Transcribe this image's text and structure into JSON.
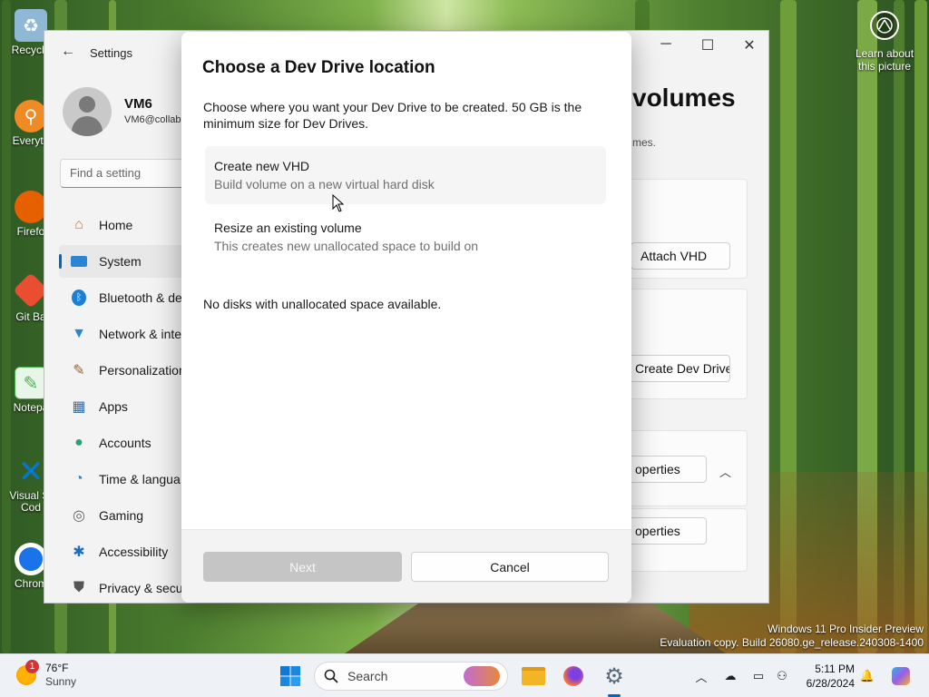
{
  "desktop": {
    "icons": [
      {
        "label": "Recycle",
        "icon": "recycle-bin-icon",
        "color": "#8fb7d6"
      },
      {
        "label": "Everyth",
        "icon": "everything-search-icon",
        "color": "#f08a24"
      },
      {
        "label": "Firefo",
        "icon": "firefox-icon",
        "color": "#e66000"
      },
      {
        "label": "Git Ba",
        "icon": "git-bash-icon",
        "color": "#e94e31"
      },
      {
        "label": "Notepa",
        "icon": "notepad-icon",
        "color": "#4caf50"
      },
      {
        "label": "Visual St Cod",
        "icon": "vscode-icon",
        "color": "#0078d4"
      },
      {
        "label": "Chrom",
        "icon": "chrome-icon",
        "color": "#1a73e8"
      }
    ],
    "learn_about": {
      "line1": "Learn about",
      "line2": "this picture"
    },
    "watermark": {
      "line1": "Windows 11 Pro Insider Preview",
      "line2": "Evaluation copy. Build 26080.ge_release.240308-1400"
    }
  },
  "settings": {
    "title": "Settings",
    "user": {
      "name": "VM6",
      "email": "VM6@collab"
    },
    "search_placeholder": "Find a setting",
    "nav": [
      {
        "label": "Home",
        "icon": "home-icon",
        "selected": false
      },
      {
        "label": "System",
        "icon": "system-icon",
        "selected": true
      },
      {
        "label": "Bluetooth & de",
        "icon": "bluetooth-icon",
        "selected": false
      },
      {
        "label": "Network & inte",
        "icon": "network-icon",
        "selected": false
      },
      {
        "label": "Personalization",
        "icon": "brush-icon",
        "selected": false
      },
      {
        "label": "Apps",
        "icon": "apps-icon",
        "selected": false
      },
      {
        "label": "Accounts",
        "icon": "accounts-icon",
        "selected": false
      },
      {
        "label": "Time & langua",
        "icon": "time-language-icon",
        "selected": false
      },
      {
        "label": "Gaming",
        "icon": "gaming-icon",
        "selected": false
      },
      {
        "label": "Accessibility",
        "icon": "accessibility-icon",
        "selected": false
      },
      {
        "label": "Privacy & secu",
        "icon": "shield-icon",
        "selected": false
      }
    ],
    "page_heading": "volumes",
    "page_sub": "mes.",
    "buttons": {
      "attach_vhd": "Attach VHD",
      "create_dev_drive": "Create Dev Drive",
      "properties_1": "operties",
      "properties_2": "operties"
    }
  },
  "dialog": {
    "title": "Choose a Dev Drive location",
    "description": "Choose where you want your Dev Drive to be created. 50 GB is the minimum size for Dev Drives.",
    "options": [
      {
        "title": "Create new VHD",
        "subtitle": "Build volume on a new virtual hard disk"
      },
      {
        "title": "Resize an existing volume",
        "subtitle": "This creates new unallocated space to build on"
      }
    ],
    "no_disks": "No disks with unallocated space available.",
    "next_label": "Next",
    "cancel_label": "Cancel"
  },
  "taskbar": {
    "weather": {
      "temp": "76°F",
      "condition": "Sunny",
      "badge": "1"
    },
    "search_placeholder": "Search",
    "clock": {
      "time": "5:11 PM",
      "date": "6/28/2024"
    }
  }
}
